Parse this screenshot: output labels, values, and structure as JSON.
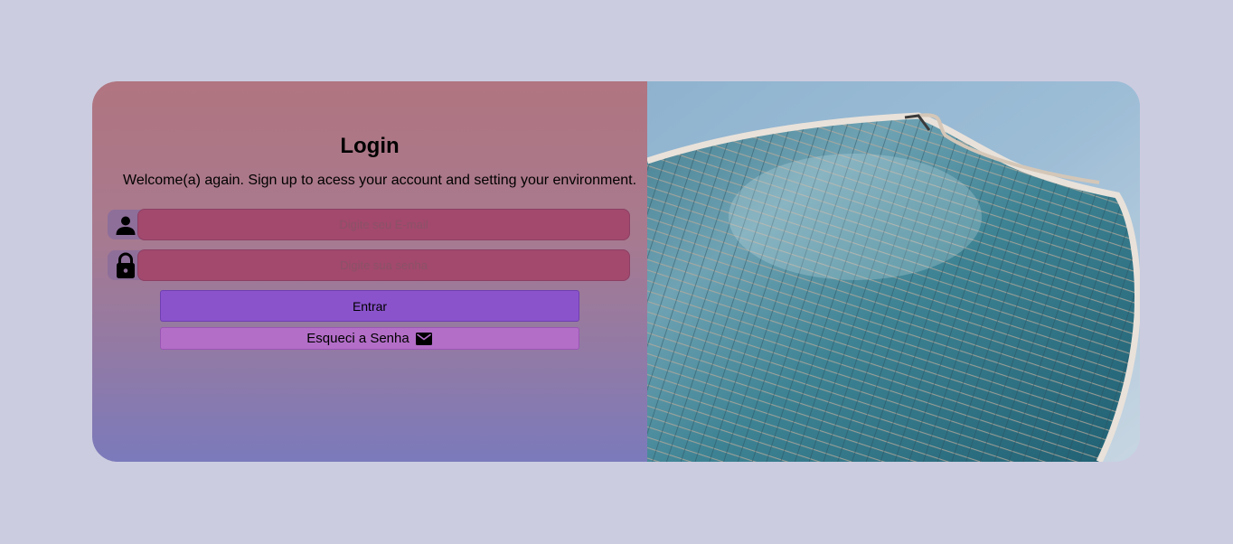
{
  "login": {
    "title": "Login",
    "subtitle": "Welcome(a) again. Sign up to acess your account and setting your environment.",
    "email": {
      "placeholder": "Digite seu E-mail",
      "value": ""
    },
    "password": {
      "placeholder": "Digite sua senha",
      "value": ""
    },
    "enter_label": "Entrar",
    "forgot_label": "Esqueci a Senha"
  },
  "icons": {
    "email_field": "person-icon",
    "password_field": "lock-icon",
    "forgot_button": "envelope-icon"
  },
  "colors": {
    "page_background": "#cccce0",
    "input_background": "#a2496d",
    "enter_button": "#8a53cc",
    "forgot_button": "#b36ec8"
  }
}
